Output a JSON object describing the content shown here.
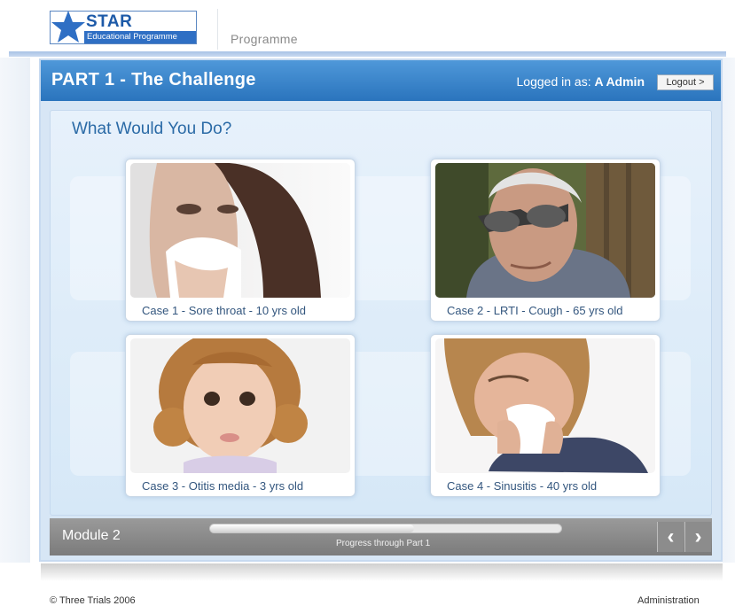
{
  "brand": {
    "title": "STAR",
    "subtitle": "Educational Programme",
    "logo_icon": "star-icon"
  },
  "programme_label": "Programme",
  "header": {
    "part_title": "PART 1 - The Challenge",
    "logged_in_prefix": "Logged in as:",
    "user_name": "A Admin",
    "logout_label": "Logout >"
  },
  "content": {
    "question": "What Would You Do?",
    "cases": [
      {
        "label": "Case 1 - Sore throat - 10 yrs old",
        "image": "girl-with-tissue"
      },
      {
        "label": "Case 2 - LRTI - Cough - 65 yrs old",
        "image": "older-man-sunglasses"
      },
      {
        "label": "Case 3 - Otitis media - 3 yrs old",
        "image": "toddler-portrait"
      },
      {
        "label": "Case 4 - Sinusitis - 40 yrs old",
        "image": "woman-blowing-nose"
      }
    ]
  },
  "module_bar": {
    "module_label": "Module 2",
    "progress_fraction": 0.58,
    "progress_label": "Progress through Part 1",
    "prev_icon": "chevron-left-icon",
    "next_icon": "chevron-right-icon"
  },
  "footer": {
    "copyright": "© Three Trials 2006",
    "admin_link": "Administration"
  }
}
